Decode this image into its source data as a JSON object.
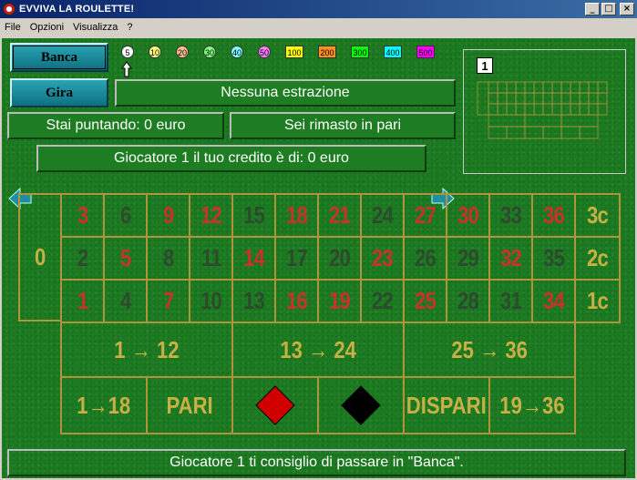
{
  "window": {
    "title": "EVVIVA LA ROULETTE!",
    "min": "_",
    "max": "□",
    "close": "×"
  },
  "menu": [
    "File",
    "Opzioni",
    "Visualizza",
    "?"
  ],
  "buttons": {
    "bank": "Banca",
    "spin": "Gira"
  },
  "chips": [
    {
      "label": "5",
      "color": "#ffffff",
      "shape": "round"
    },
    {
      "label": "10",
      "color": "#ffff80",
      "shape": "round"
    },
    {
      "label": "20",
      "color": "#ffc090",
      "shape": "round"
    },
    {
      "label": "30",
      "color": "#80ff80",
      "shape": "round"
    },
    {
      "label": "40",
      "color": "#80ffff",
      "shape": "round"
    },
    {
      "label": "50",
      "color": "#ff80ff",
      "shape": "round"
    },
    {
      "label": "100",
      "color": "#ffff00",
      "shape": "rect"
    },
    {
      "label": "200",
      "color": "#ff9020",
      "shape": "rect"
    },
    {
      "label": "300",
      "color": "#00ff00",
      "shape": "rect"
    },
    {
      "label": "400",
      "color": "#00ffff",
      "shape": "rect"
    },
    {
      "label": "500",
      "color": "#ff00ff",
      "shape": "rect"
    }
  ],
  "selected_chip_icon": "up-arrow-icon",
  "extraction": "Nessuna estrazione",
  "betting": "Stai puntando: 0 euro",
  "result": "Sei rimasto in pari",
  "player_credit": "Giocatore 1 il tuo credito è di: 0 euro",
  "preview_player": "1",
  "board": {
    "zero": "0",
    "rows": [
      [
        {
          "n": "3",
          "c": "red"
        },
        {
          "n": "6",
          "c": "black"
        },
        {
          "n": "9",
          "c": "red"
        },
        {
          "n": "12",
          "c": "red"
        },
        {
          "n": "15",
          "c": "black"
        },
        {
          "n": "18",
          "c": "red"
        },
        {
          "n": "21",
          "c": "red"
        },
        {
          "n": "24",
          "c": "black"
        },
        {
          "n": "27",
          "c": "red"
        },
        {
          "n": "30",
          "c": "red"
        },
        {
          "n": "33",
          "c": "black"
        },
        {
          "n": "36",
          "c": "red"
        }
      ],
      [
        {
          "n": "2",
          "c": "black"
        },
        {
          "n": "5",
          "c": "red"
        },
        {
          "n": "8",
          "c": "black"
        },
        {
          "n": "11",
          "c": "black"
        },
        {
          "n": "14",
          "c": "red"
        },
        {
          "n": "17",
          "c": "black"
        },
        {
          "n": "20",
          "c": "black"
        },
        {
          "n": "23",
          "c": "red"
        },
        {
          "n": "26",
          "c": "black"
        },
        {
          "n": "29",
          "c": "black"
        },
        {
          "n": "32",
          "c": "red"
        },
        {
          "n": "35",
          "c": "black"
        }
      ],
      [
        {
          "n": "1",
          "c": "red"
        },
        {
          "n": "4",
          "c": "black"
        },
        {
          "n": "7",
          "c": "red"
        },
        {
          "n": "10",
          "c": "black"
        },
        {
          "n": "13",
          "c": "black"
        },
        {
          "n": "16",
          "c": "red"
        },
        {
          "n": "19",
          "c": "red"
        },
        {
          "n": "22",
          "c": "black"
        },
        {
          "n": "25",
          "c": "red"
        },
        {
          "n": "28",
          "c": "black"
        },
        {
          "n": "31",
          "c": "black"
        },
        {
          "n": "34",
          "c": "red"
        }
      ]
    ],
    "columns": [
      "3c",
      "2c",
      "1c"
    ],
    "dozens": [
      "1 → 12",
      "13 → 24",
      "25 → 36"
    ],
    "outside": [
      "1→18",
      "PARI",
      "red-diamond",
      "black-diamond",
      "DISPARI",
      "19→36"
    ]
  },
  "status_message": "Giocatore 1 ti consiglio di passare in \"Banca\"."
}
